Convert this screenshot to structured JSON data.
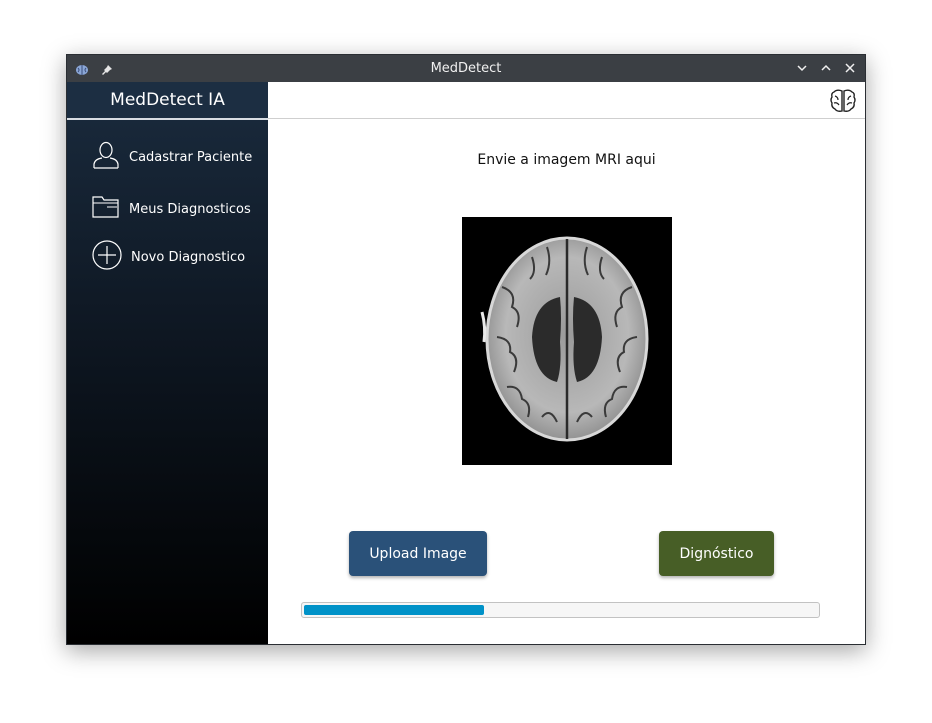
{
  "window": {
    "title": "MedDetect",
    "controls": [
      "minimize",
      "maximize",
      "close"
    ]
  },
  "sidebar": {
    "title": "MedDetect IA",
    "items": [
      {
        "label": "Cadastrar Paciente",
        "icon": "user-icon"
      },
      {
        "label": "Meus Diagnosticos",
        "icon": "folder-icon"
      },
      {
        "label": "Novo Diagnostico",
        "icon": "plus-circle-icon"
      }
    ]
  },
  "header": {
    "icon": "brain-icon"
  },
  "main": {
    "prompt": "Envie a imagem MRI aqui",
    "image_alt": "brain-mri-scan",
    "upload_label": "Upload Image",
    "diagnose_label": "Dignóstico",
    "progress": 0.35
  },
  "colors": {
    "sidebar_top": "#1a2b3e",
    "sidebar_bottom": "#000000",
    "upload_button": "#2a5179",
    "diagnose_button": "#475e26",
    "progress_fill": "#0092c8"
  }
}
